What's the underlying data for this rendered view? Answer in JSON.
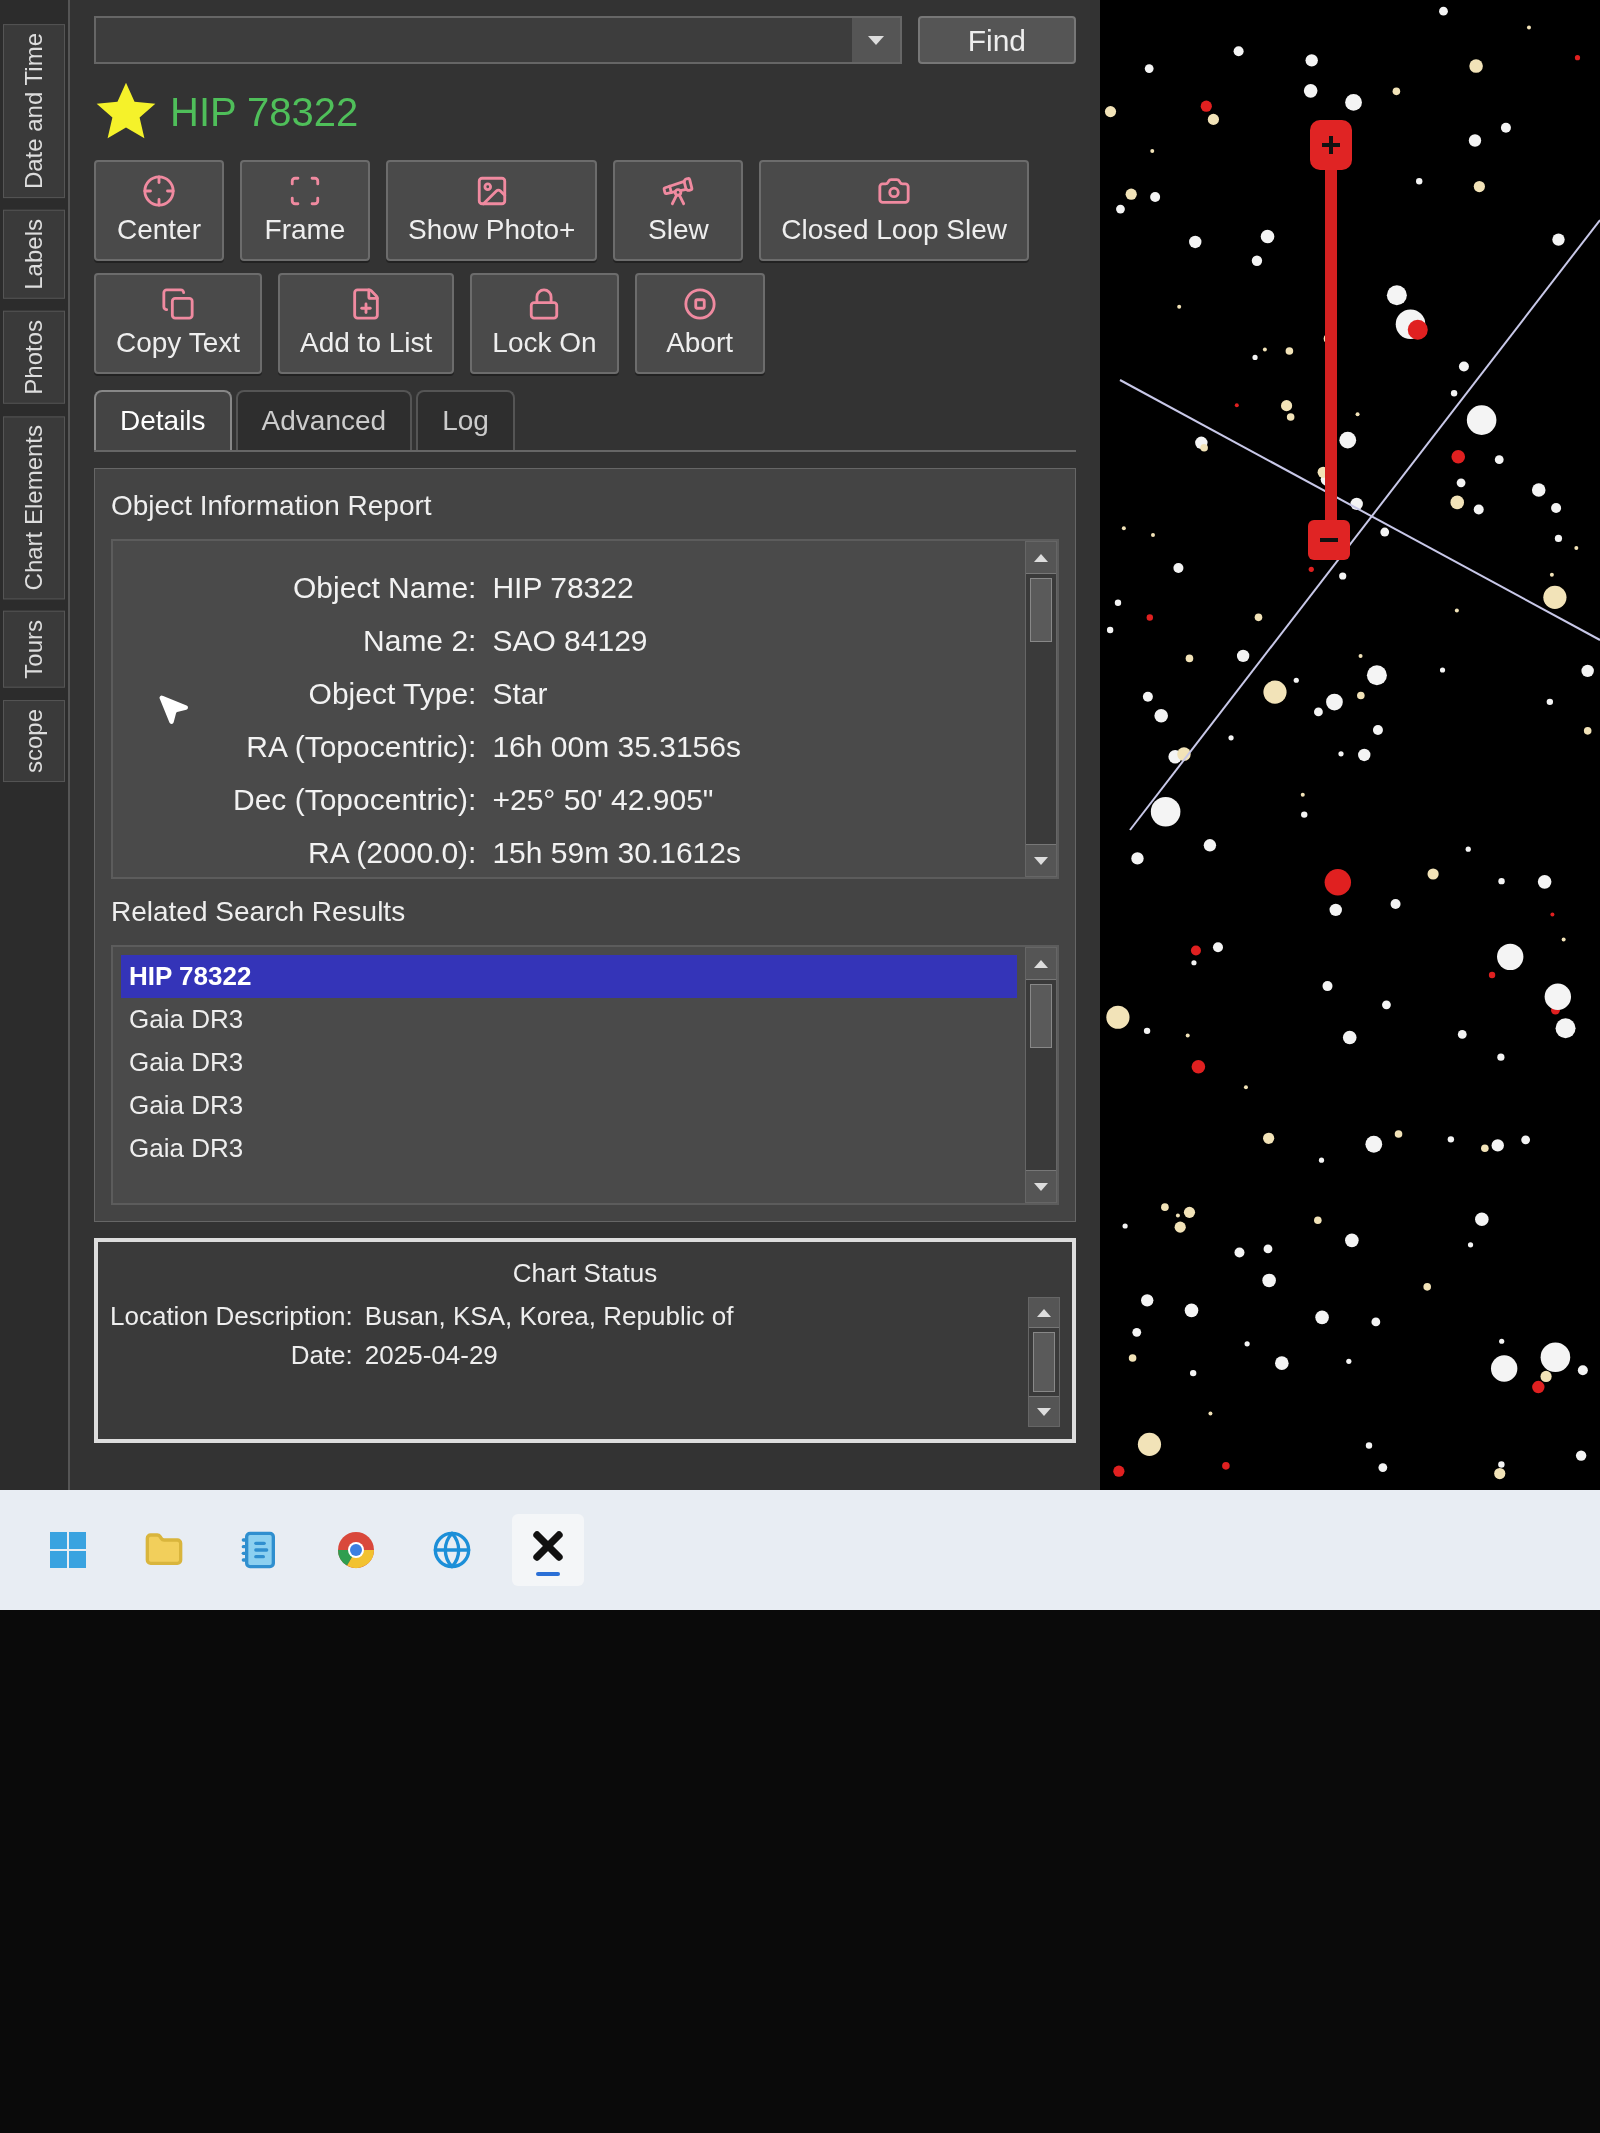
{
  "sidebar_tabs": [
    "Date and Time",
    "Labels",
    "Photos",
    "Chart Elements",
    "Tours",
    "scope"
  ],
  "find_button": "Find",
  "object_title": "HIP 78322",
  "action_rows": [
    [
      "Center",
      "Frame",
      "Show Photo+",
      "Slew",
      "Closed Loop Slew"
    ],
    [
      "Copy Text",
      "Add to List",
      "Lock On",
      "Abort"
    ]
  ],
  "tabs": [
    {
      "label": "Details",
      "selected": true
    },
    {
      "label": "Advanced",
      "selected": false
    },
    {
      "label": "Log",
      "selected": false
    }
  ],
  "report": {
    "title": "Object Information Report",
    "rows": [
      {
        "label": "Object Name:",
        "value": "HIP 78322"
      },
      {
        "label": "Name 2:",
        "value": "SAO 84129"
      },
      {
        "label": "Object Type:",
        "value": "Star"
      },
      {
        "label": "RA (Topocentric):",
        "value": "16h 00m 35.3156s"
      },
      {
        "label": "Dec (Topocentric):",
        "value": "+25° 50' 42.905\""
      },
      {
        "label": "RA (2000.0):",
        "value": "15h 59m 30.1612s"
      }
    ]
  },
  "results": {
    "title": "Related Search Results",
    "items": [
      {
        "label": "HIP 78322",
        "selected": true
      },
      {
        "label": "Gaia DR3",
        "selected": false
      },
      {
        "label": "Gaia DR3",
        "selected": false
      },
      {
        "label": "Gaia DR3",
        "selected": false
      },
      {
        "label": "Gaia DR3",
        "selected": false
      }
    ]
  },
  "chart_status": {
    "title": "Chart Status",
    "lines": [
      {
        "label": "Location Description:",
        "value": "Busan, KSA, Korea, Republic of"
      },
      {
        "label": "Date:",
        "value": "2025-04-29"
      }
    ]
  },
  "taskbar": [
    {
      "kind": "start",
      "active": false
    },
    {
      "kind": "folder",
      "active": false
    },
    {
      "kind": "notepad",
      "active": false
    },
    {
      "kind": "browser",
      "active": false
    },
    {
      "kind": "edge",
      "active": false
    },
    {
      "kind": "x",
      "active": true
    }
  ]
}
